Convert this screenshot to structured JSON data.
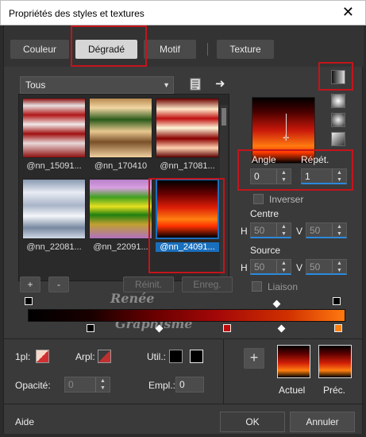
{
  "window": {
    "title": "Propriétés des styles et textures",
    "close_glyph": "✕"
  },
  "tabs": [
    {
      "label": "Couleur"
    },
    {
      "label": "Dégradé"
    },
    {
      "label": "Motif"
    },
    {
      "label": "Texture"
    }
  ],
  "category": {
    "value": "Tous"
  },
  "gallery": {
    "items": [
      {
        "label": "@nn_15091..."
      },
      {
        "label": "@nn_170410"
      },
      {
        "label": "@nn_17081..."
      },
      {
        "label": "@nn_22081..."
      },
      {
        "label": "@nn_22091..."
      },
      {
        "label": "@nn_24091..."
      }
    ]
  },
  "gallery_buttons": {
    "add": "+",
    "remove": "-",
    "reset": "Réinit.",
    "save": "Enreg."
  },
  "angle": {
    "label": "Angle",
    "value": "0"
  },
  "repeat": {
    "label": "Répét.",
    "value": "1"
  },
  "invert": {
    "label": "Inverser"
  },
  "center": {
    "label": "Centre",
    "h_label": "H",
    "h_value": "50",
    "v_label": "V",
    "v_value": "50"
  },
  "source": {
    "label": "Source",
    "h_label": "H",
    "h_value": "50",
    "v_label": "V",
    "v_value": "50"
  },
  "link": {
    "label": "Liaison"
  },
  "watermark": {
    "line1": "Renée",
    "line2": "Graphisme"
  },
  "stops": {
    "fg_label": "1pl:",
    "bg_label": "Arpl:",
    "use_label": "Util.:",
    "opacity_label": "Opacité:",
    "opacity_value": "0",
    "position_label": "Empl.:",
    "position_value": "0"
  },
  "result": {
    "current_label": "Actuel",
    "previous_label": "Préc."
  },
  "footer": {
    "help": "Aide",
    "ok": "OK",
    "cancel": "Annuler"
  },
  "colors": {
    "accent_red_box": "#c4141c",
    "selection_blue": "#1a6fbd",
    "gradient_start": "#000000",
    "gradient_end": "#ff7a10"
  }
}
